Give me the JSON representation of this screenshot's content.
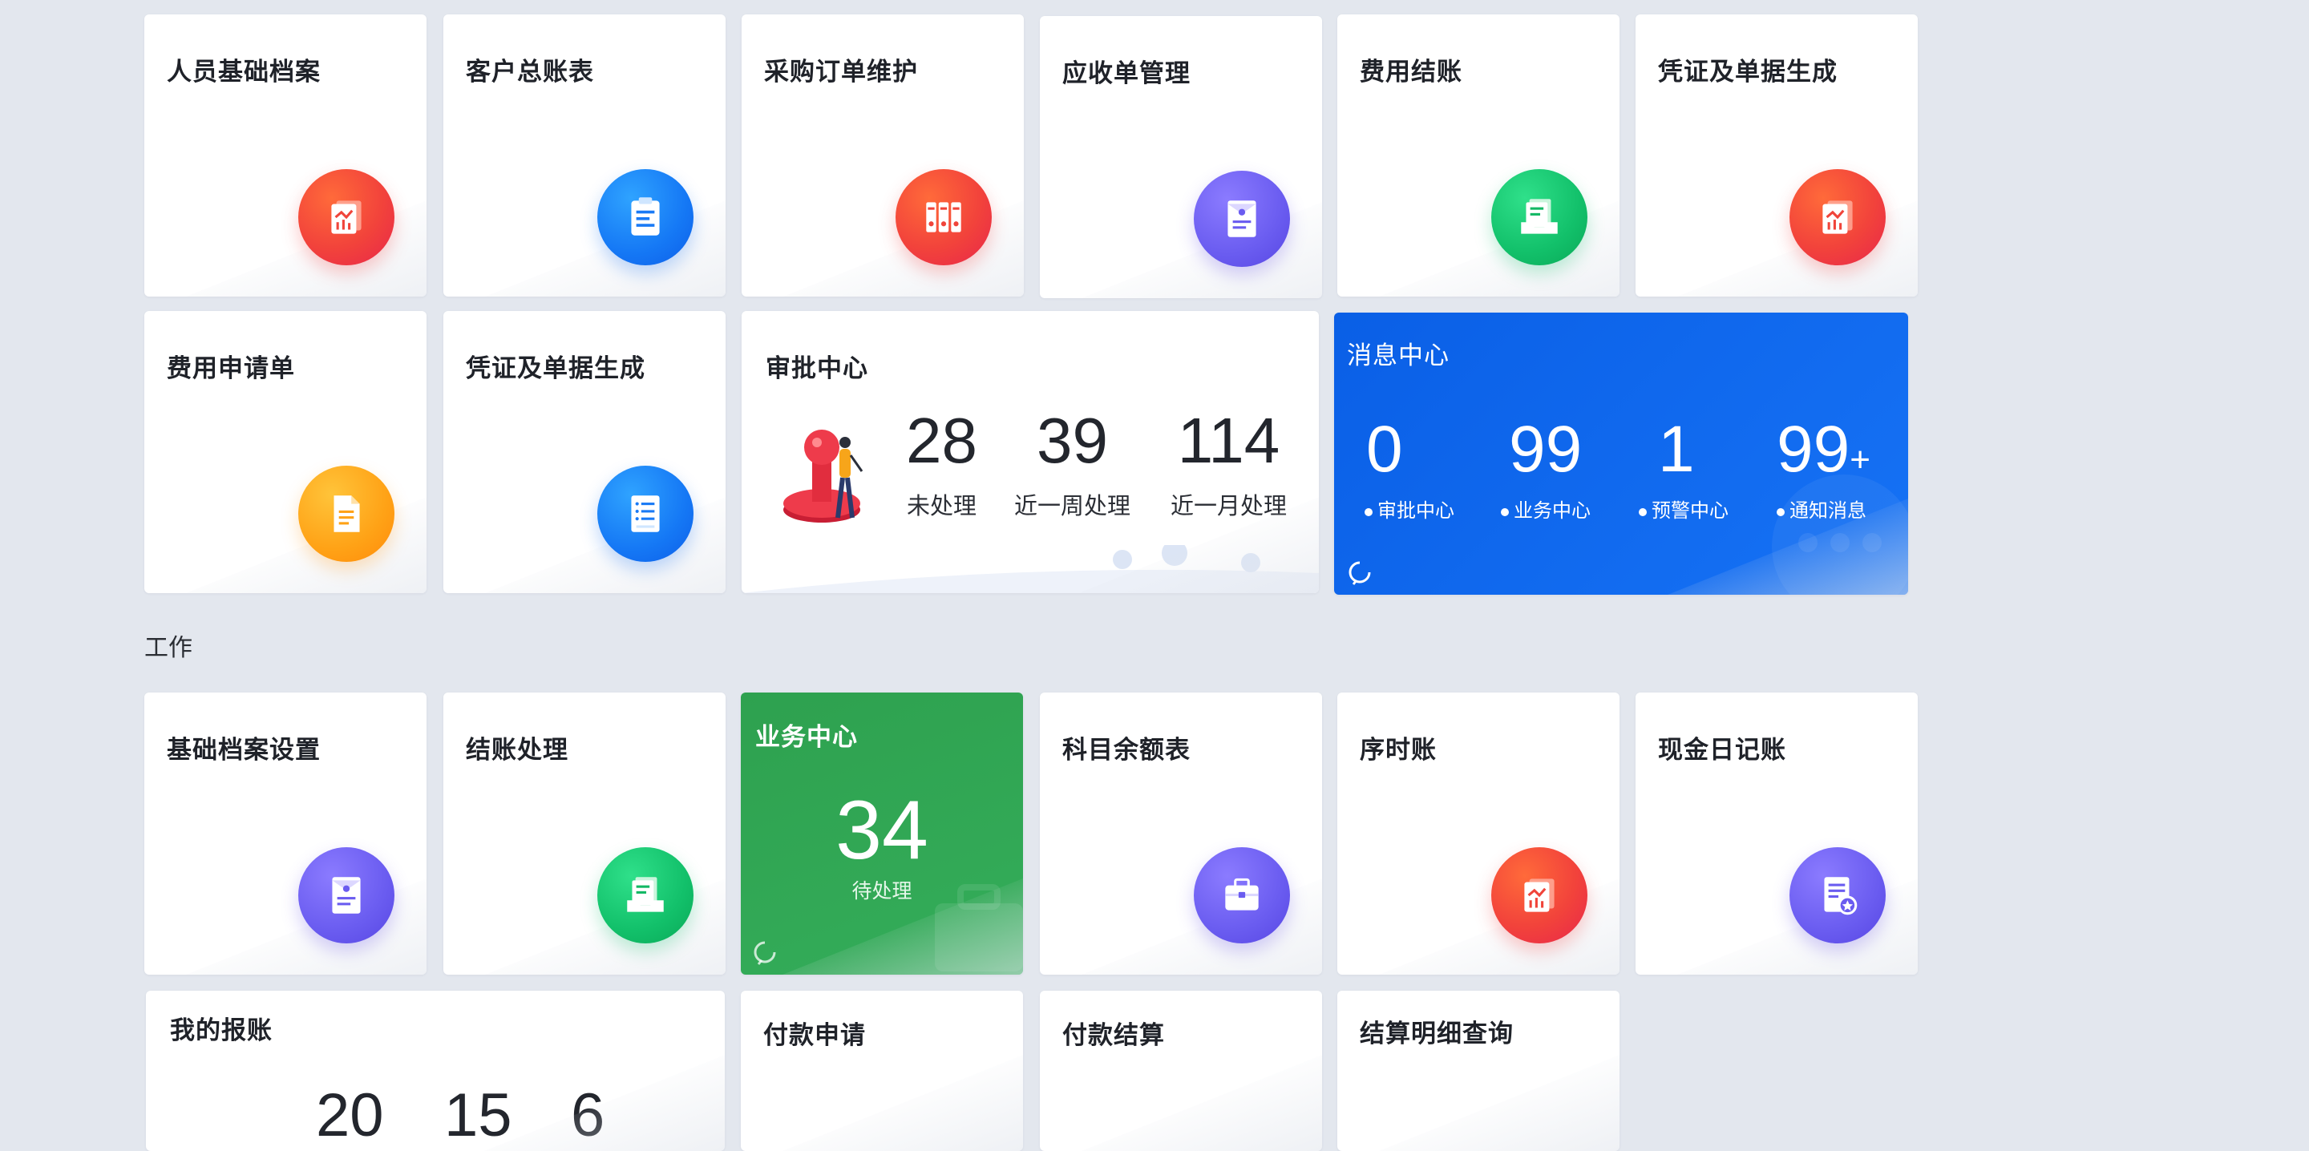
{
  "row1": [
    {
      "title": "人员基础档案",
      "icon": "chart-doc-icon",
      "color": "red"
    },
    {
      "title": "客户总账表",
      "icon": "clipboard-icon",
      "color": "blue"
    },
    {
      "title": "采购订单维护",
      "icon": "binders-icon",
      "color": "red"
    },
    {
      "title": "应收单管理",
      "icon": "envelope-doc-icon",
      "color": "purple"
    },
    {
      "title": "费用结账",
      "icon": "tray-doc-icon",
      "color": "green"
    },
    {
      "title": "凭证及单据生成",
      "icon": "chart-doc-icon",
      "color": "red"
    }
  ],
  "row2": [
    {
      "title": "费用申请单",
      "icon": "document-icon",
      "color": "orange"
    },
    {
      "title": "凭证及单据生成",
      "icon": "list-doc-icon",
      "color": "blue"
    }
  ],
  "approval": {
    "title": "审批中心",
    "stats": [
      {
        "value": "28",
        "label": "未处理"
      },
      {
        "value": "39",
        "label": "近一周处理"
      },
      {
        "value": "114",
        "label": "近一月处理"
      }
    ]
  },
  "messages": {
    "title": "消息中心",
    "stats": [
      {
        "value": "0",
        "label": "审批中心"
      },
      {
        "value": "99",
        "label": "业务中心"
      },
      {
        "value": "1",
        "label": "预警中心"
      },
      {
        "value": "99",
        "suffix": "+",
        "label": "通知消息"
      }
    ],
    "color": "#1268f0"
  },
  "section_work": "工作",
  "row3": [
    {
      "title": "基础档案设置",
      "icon": "envelope-doc-icon",
      "color": "purple"
    },
    {
      "title": "结账处理",
      "icon": "tray-doc-icon",
      "color": "green"
    },
    {
      "title": "科目余额表",
      "icon": "briefcase-icon",
      "color": "purple"
    },
    {
      "title": "序时账",
      "icon": "chart-doc-icon",
      "color": "red"
    },
    {
      "title": "现金日记账",
      "icon": "star-doc-icon",
      "color": "purple"
    }
  ],
  "business": {
    "title": "业务中心",
    "value": "34",
    "label": "待处理",
    "color": "#2da44e"
  },
  "expense": {
    "title": "我的报账",
    "stats": [
      "20",
      "15",
      "6"
    ]
  },
  "row4": [
    {
      "title": "付款申请"
    },
    {
      "title": "付款结算"
    },
    {
      "title": "结算明细查询"
    }
  ]
}
